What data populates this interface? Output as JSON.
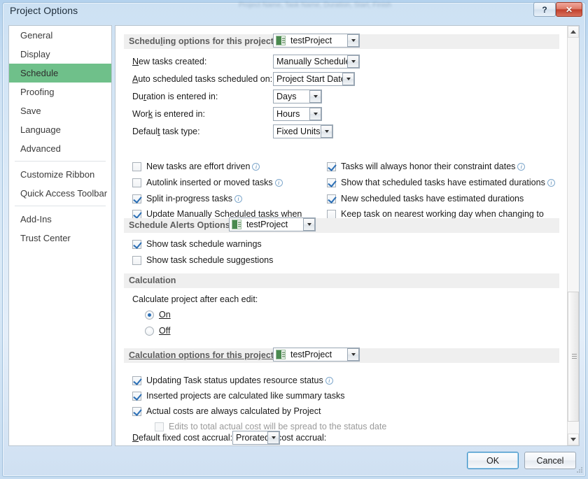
{
  "window": {
    "title": "Project Options",
    "ghost_behind": "Project Name, Task Name, Duration, Start, Finish",
    "help_button": "?",
    "close_button": "✕"
  },
  "sidebar": {
    "items": [
      {
        "label": "General",
        "selected": false,
        "sep_after": false
      },
      {
        "label": "Display",
        "selected": false,
        "sep_after": false
      },
      {
        "label": "Schedule",
        "selected": true,
        "sep_after": false
      },
      {
        "label": "Proofing",
        "selected": false,
        "sep_after": false
      },
      {
        "label": "Save",
        "selected": false,
        "sep_after": false
      },
      {
        "label": "Language",
        "selected": false,
        "sep_after": false
      },
      {
        "label": "Advanced",
        "selected": false,
        "sep_after": true
      },
      {
        "label": "Customize Ribbon",
        "selected": false,
        "sep_after": false
      },
      {
        "label": "Quick Access Toolbar",
        "selected": false,
        "sep_after": true
      },
      {
        "label": "Add-Ins",
        "selected": false,
        "sep_after": false
      },
      {
        "label": "Trust Center",
        "selected": false,
        "sep_after": false
      }
    ]
  },
  "scheduling": {
    "header": "Scheduling options for this project:",
    "project_combo": "testProject",
    "fields": [
      {
        "label": "New tasks created:",
        "value": "Manually Scheduled"
      },
      {
        "label": "Auto scheduled tasks scheduled on:",
        "value": "Project Start Date"
      },
      {
        "label": "Duration is entered in:",
        "value": "Days"
      },
      {
        "label": "Work is entered in:",
        "value": "Hours"
      },
      {
        "label": "Default task type:",
        "value": "Fixed Units"
      }
    ],
    "checks_left": [
      {
        "label": "New tasks are effort driven",
        "checked": false,
        "info": true
      },
      {
        "label": "Autolink inserted or moved tasks",
        "checked": false,
        "info": true
      },
      {
        "label": "Split in-progress tasks",
        "checked": true,
        "info": true
      },
      {
        "label": "Update Manually Scheduled tasks when editing links",
        "checked": true,
        "info": false
      }
    ],
    "checks_right": [
      {
        "label": "Tasks will always honor their constraint dates",
        "checked": true,
        "info": true
      },
      {
        "label": "Show that scheduled tasks have estimated durations",
        "checked": true,
        "info": true
      },
      {
        "label": "New scheduled tasks have estimated durations",
        "checked": true,
        "info": false
      },
      {
        "label": "Keep task on nearest working day when changing to Automatically Scheduled mode",
        "checked": false,
        "info": false
      }
    ]
  },
  "alerts": {
    "header": "Schedule Alerts Options:",
    "project_combo": "testProject",
    "checks": [
      {
        "label": "Show task schedule warnings",
        "checked": true
      },
      {
        "label": "Show task schedule suggestions",
        "checked": false
      }
    ]
  },
  "calculation": {
    "header": "Calculation",
    "group_label": "Calculate project after each edit:",
    "radios": [
      {
        "label": "On",
        "selected": true
      },
      {
        "label": "Off",
        "selected": false
      }
    ]
  },
  "calc_options": {
    "header": "Calculation options for this project:",
    "project_combo": "testProject",
    "checks": [
      {
        "label": "Updating Task status updates resource status",
        "checked": true,
        "info": true,
        "disabled": false,
        "indent": false
      },
      {
        "label": "Inserted projects are calculated like summary tasks",
        "checked": true,
        "info": false,
        "disabled": false,
        "indent": false
      },
      {
        "label": "Actual costs are always calculated by Project",
        "checked": true,
        "info": false,
        "disabled": false,
        "indent": false
      },
      {
        "label": "Edits to total actual cost will be spread to the status date",
        "checked": false,
        "info": false,
        "disabled": true,
        "indent": true
      }
    ],
    "accrual_label": "Default fixed cost accrual:",
    "accrual_value": "Prorated"
  },
  "footer": {
    "ok": "OK",
    "cancel": "Cancel"
  },
  "colors": {
    "accent_selection": "#6fc08a",
    "titlebar": "#cfe2f4",
    "close_button": "#c1402c",
    "section_header_bg": "#efefef",
    "check_mark": "#2c6fb5"
  }
}
